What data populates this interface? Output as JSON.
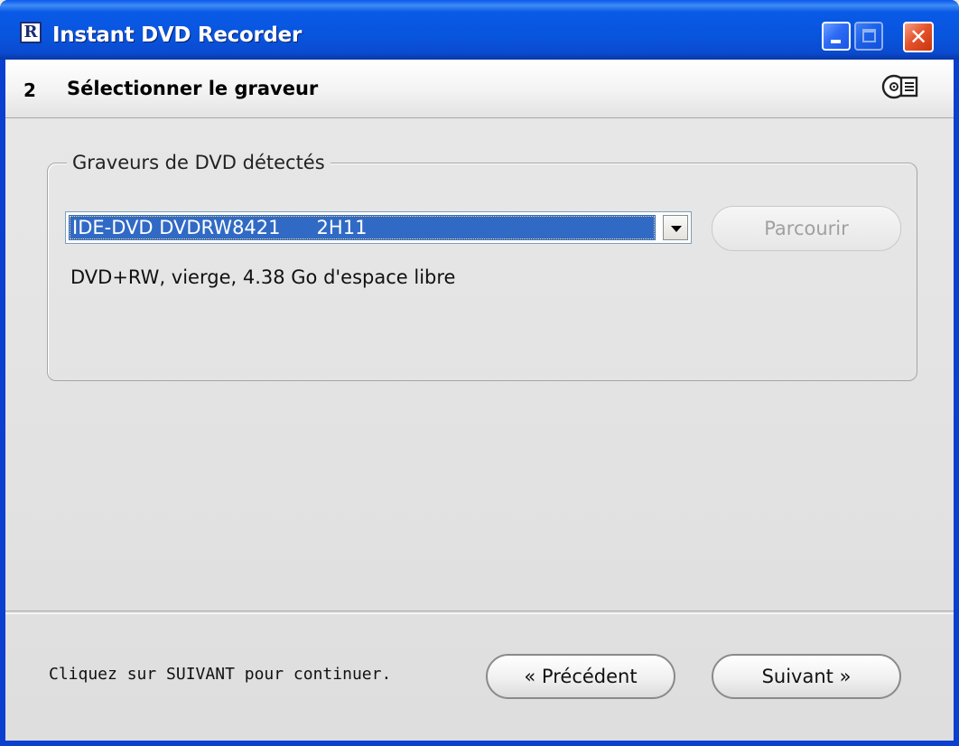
{
  "window": {
    "title": "Instant DVD Recorder",
    "icon_letter": "R"
  },
  "header": {
    "step_number": "2",
    "step_title": "Sélectionner le graveur"
  },
  "group": {
    "label": "Graveurs de DVD détectés",
    "drive_select": {
      "selected_value": "IDE-DVD DVDRW8421      2H11"
    },
    "browse_label": "Parcourir",
    "browse_enabled": false,
    "disc_info": "DVD+RW, vierge, 4.38 Go d'espace libre"
  },
  "footer": {
    "hint": "Cliquez sur SUIVANT pour continuer.",
    "prev_label": "« Précédent",
    "next_label": "Suivant »"
  },
  "colors": {
    "titlebar": "#0855dd",
    "selection": "#316ac5",
    "close_button": "#e5542d"
  }
}
